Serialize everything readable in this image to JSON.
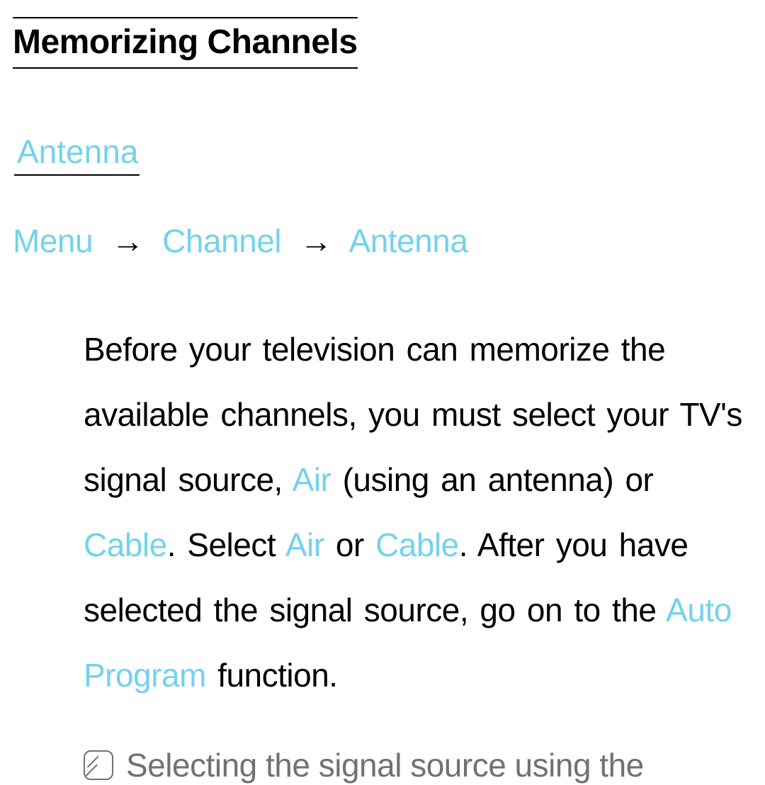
{
  "title": "Memorizing Channels",
  "subhead": "Antenna",
  "breadcrumb": {
    "items": [
      "Menu",
      "Channel",
      "Antenna"
    ],
    "sep": "→"
  },
  "body": {
    "t0": "Before your television can memorize the available channels, you must select your TV's signal source, ",
    "air1": "Air",
    "t1": " (using an antenna) or ",
    "cable1": "Cable",
    "t2": ". Select ",
    "air2": "Air",
    "t3": " or ",
    "cable2": "Cable",
    "t4": ". After you have selected the signal source, go on to the ",
    "auto": "Auto Program",
    "t5": " function."
  },
  "note": {
    "text": "Selecting the signal source using the"
  }
}
